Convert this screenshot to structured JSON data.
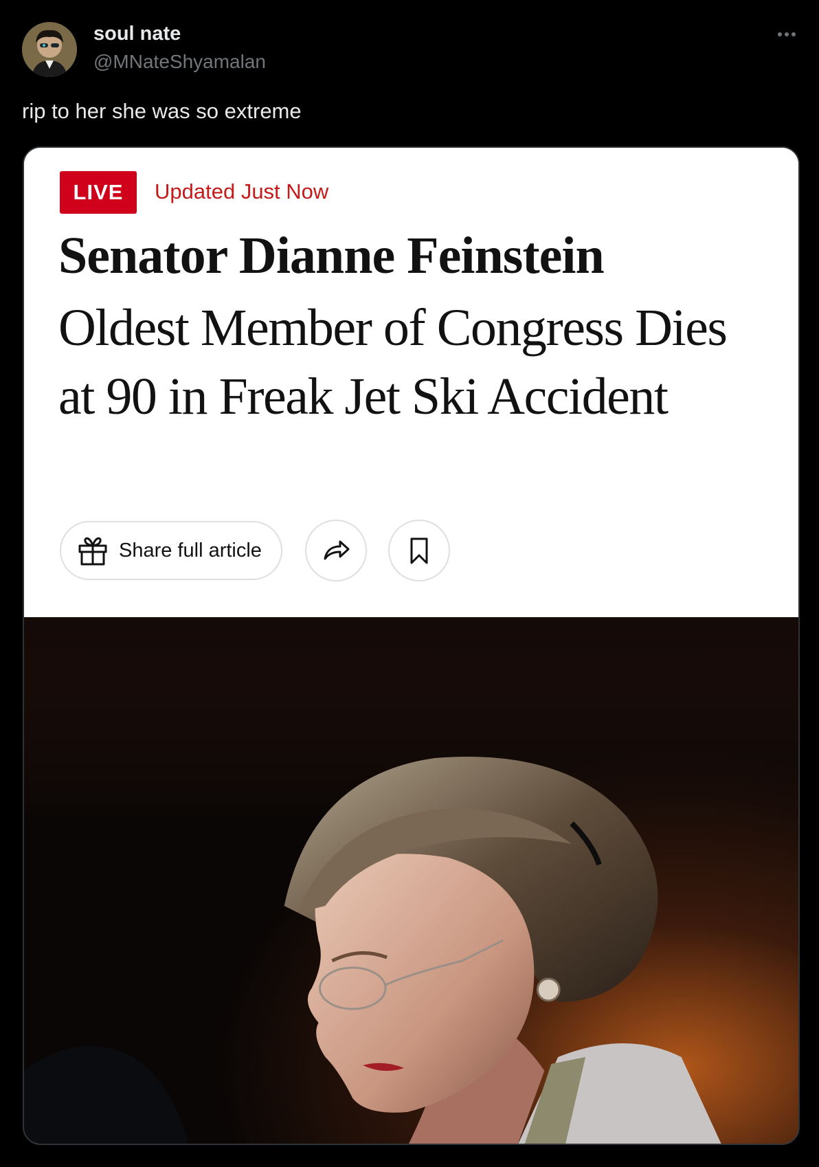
{
  "tweet": {
    "display_name": "soul nate",
    "handle": "@MNateShyamalan",
    "text": "rip to her she was so extreme"
  },
  "card": {
    "live_label": "LIVE",
    "updated_label": "Updated Just Now",
    "headline_bold": "Senator Dianne Feinstein",
    "headline_rest": "Oldest Member of Congress Dies at 90 in Freak Jet Ski Accident",
    "share_label": "Share full article"
  },
  "colors": {
    "live_red": "#d0021b",
    "updated_red": "#c41a1a",
    "background": "#000000"
  },
  "icons": [
    "more-icon",
    "gift-icon",
    "forward-arrow-icon",
    "bookmark-icon"
  ]
}
